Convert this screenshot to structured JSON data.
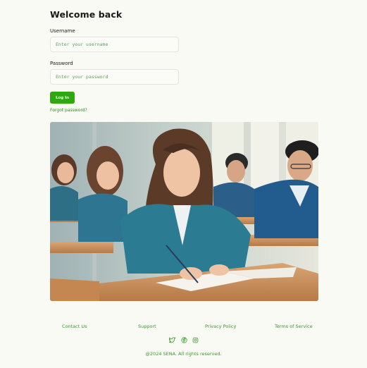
{
  "login": {
    "title": "Welcome back",
    "username_label": "Username",
    "username_placeholder": "Enter your username",
    "password_label": "Password",
    "password_placeholder": "Enter your password",
    "login_button": "Log In",
    "forgot_link": "Forgot password?"
  },
  "hero": {
    "icon": "classroom-illustration"
  },
  "footer": {
    "links": [
      "Contact Us",
      "Support",
      "Privacy Policy",
      "Terms of Service"
    ],
    "social_icons": [
      "twitter-icon",
      "facebook-icon",
      "instagram-icon"
    ],
    "copyright": "@2024 SENA. All rights reserved."
  },
  "colors": {
    "accent": "#2ea80f",
    "link": "#3a9a2a",
    "background": "#f8faf3"
  }
}
